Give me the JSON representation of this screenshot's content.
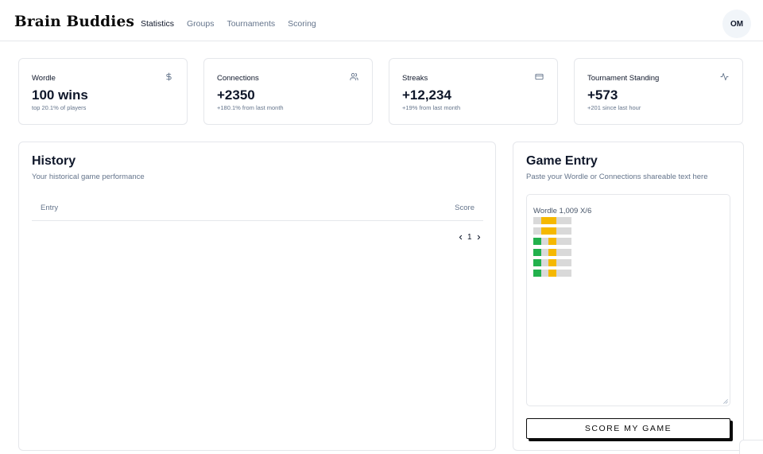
{
  "app": {
    "brand": "Brain Buddies"
  },
  "nav": [
    {
      "label": "Statistics",
      "active": true
    },
    {
      "label": "Groups",
      "active": false
    },
    {
      "label": "Tournaments",
      "active": false
    },
    {
      "label": "Scoring",
      "active": false
    }
  ],
  "user": {
    "initials": "OM"
  },
  "stats": [
    {
      "title": "Wordle",
      "value": "100 wins",
      "sub": "top 20.1% of players",
      "icon": "dollar-icon"
    },
    {
      "title": "Connections",
      "value": "+2350",
      "sub": "+180.1% from last month",
      "icon": "users-icon"
    },
    {
      "title": "Streaks",
      "value": "+12,234",
      "sub": "+19% from last month",
      "icon": "credit-card-icon"
    },
    {
      "title": "Tournament Standing",
      "value": "+573",
      "sub": "+201 since last hour",
      "icon": "activity-icon"
    }
  ],
  "history": {
    "title": "History",
    "description": "Your historical game performance",
    "columns": {
      "entry": "Entry",
      "score": "Score"
    },
    "rows": [],
    "page": "1"
  },
  "game_entry": {
    "title": "Game Entry",
    "description": "Paste your Wordle or Connections shareable text here",
    "textarea_header": "Wordle 1,009 X/6",
    "wordle_grid": [
      [
        "gray",
        "yellow",
        "yellow",
        "gray",
        "gray"
      ],
      [
        "gray",
        "yellow",
        "yellow",
        "gray",
        "gray"
      ],
      [
        "green",
        "gray",
        "yellow",
        "gray",
        "gray"
      ],
      [
        "green",
        "gray",
        "yellow",
        "gray",
        "gray"
      ],
      [
        "green",
        "gray",
        "yellow",
        "gray",
        "gray"
      ],
      [
        "green",
        "gray",
        "yellow",
        "gray",
        "gray"
      ]
    ],
    "button_label": "SCORE MY GAME"
  },
  "colors": {
    "wordle_green": "#22b14c",
    "wordle_yellow": "#f5b800",
    "wordle_gray": "#d9d9d9",
    "muted_text": "#64748b",
    "border": "#e5e7eb"
  }
}
